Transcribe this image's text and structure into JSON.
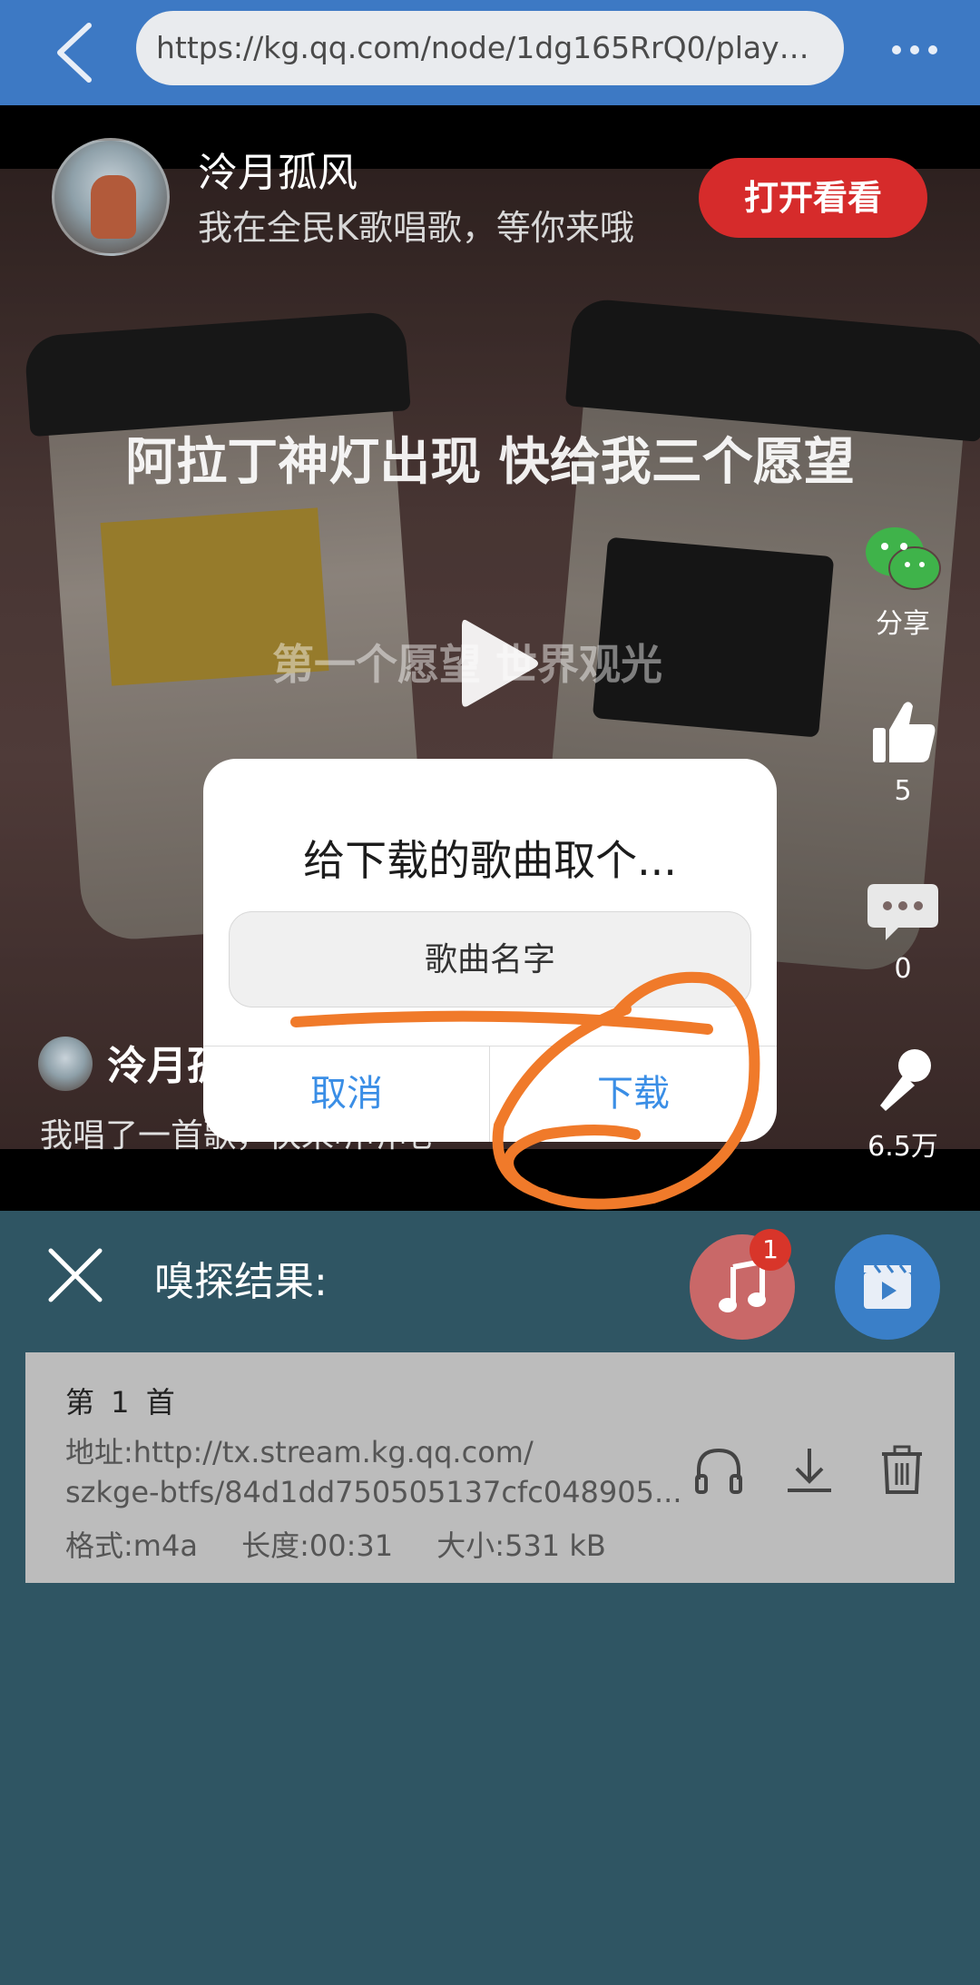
{
  "browser": {
    "url": "https://kg.qq.com/node/1dg165RrQ0/play_v..."
  },
  "video": {
    "user_name": "泠月孤风",
    "user_subtitle": "我在全民K歌唱歌，等你来哦",
    "open_button": "打开看看",
    "song_title": "阿拉丁神灯出现 快给我三个愿望",
    "lyric_line": "第一个愿望 世界观光",
    "side": {
      "share_label": "分享",
      "like_count": "5",
      "comment_count": "0",
      "sing_count": "6.5万"
    },
    "bottom_name": "泠月孤",
    "bottom_desc": "我唱了一首歌，快来听听吧"
  },
  "dialog": {
    "title": "给下载的歌曲取个...",
    "input_value": "歌曲名字",
    "cancel_label": "取消",
    "confirm_label": "下载"
  },
  "sniff": {
    "title": "嗅探结果:",
    "music_badge": "1",
    "results": [
      {
        "index": "第 1 首",
        "url_line1": "地址:http://tx.stream.kg.qq.com/",
        "url_line2": "szkge-btfs/84d1dd750505137cfc048905...",
        "format": "格式:m4a",
        "length": "长度:00:31",
        "size": "大小:531 kB"
      }
    ]
  },
  "colors": {
    "topbar": "#3d79c4",
    "open_button": "#d62b2b",
    "dialog_button": "#3a8ee6",
    "annotation": "#f07a2a",
    "panel_bg": "#2f5563"
  }
}
